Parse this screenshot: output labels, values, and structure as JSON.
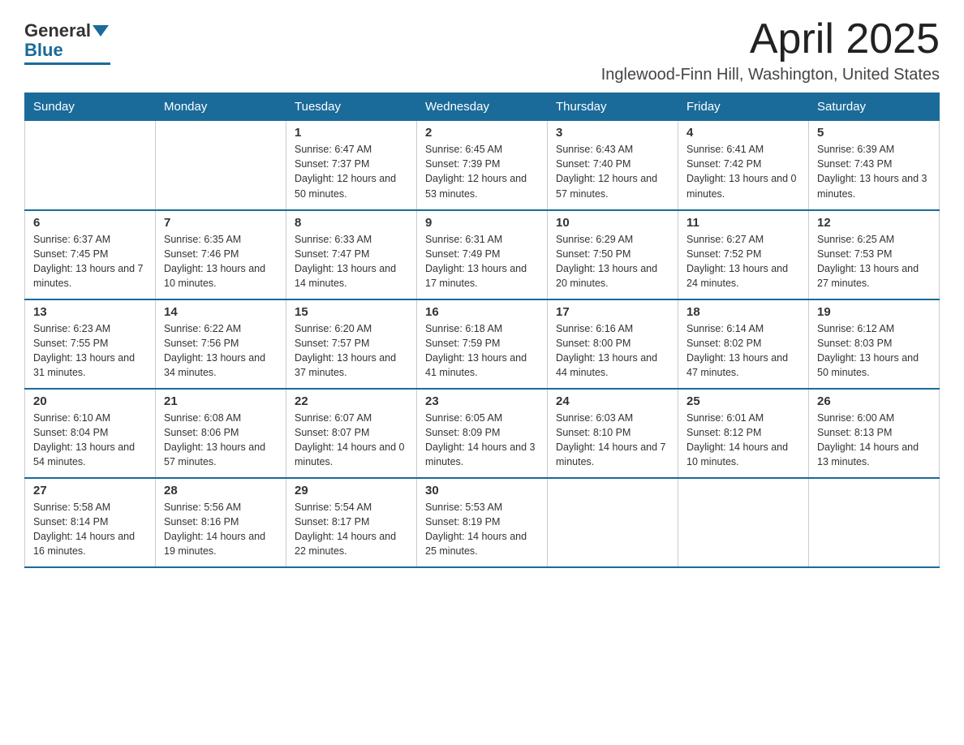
{
  "header": {
    "logo_general": "General",
    "logo_blue": "Blue",
    "month_title": "April 2025",
    "location": "Inglewood-Finn Hill, Washington, United States"
  },
  "days_of_week": [
    "Sunday",
    "Monday",
    "Tuesday",
    "Wednesday",
    "Thursday",
    "Friday",
    "Saturday"
  ],
  "weeks": [
    [
      {
        "day": "",
        "info": ""
      },
      {
        "day": "",
        "info": ""
      },
      {
        "day": "1",
        "info": "Sunrise: 6:47 AM\nSunset: 7:37 PM\nDaylight: 12 hours\nand 50 minutes."
      },
      {
        "day": "2",
        "info": "Sunrise: 6:45 AM\nSunset: 7:39 PM\nDaylight: 12 hours\nand 53 minutes."
      },
      {
        "day": "3",
        "info": "Sunrise: 6:43 AM\nSunset: 7:40 PM\nDaylight: 12 hours\nand 57 minutes."
      },
      {
        "day": "4",
        "info": "Sunrise: 6:41 AM\nSunset: 7:42 PM\nDaylight: 13 hours\nand 0 minutes."
      },
      {
        "day": "5",
        "info": "Sunrise: 6:39 AM\nSunset: 7:43 PM\nDaylight: 13 hours\nand 3 minutes."
      }
    ],
    [
      {
        "day": "6",
        "info": "Sunrise: 6:37 AM\nSunset: 7:45 PM\nDaylight: 13 hours\nand 7 minutes."
      },
      {
        "day": "7",
        "info": "Sunrise: 6:35 AM\nSunset: 7:46 PM\nDaylight: 13 hours\nand 10 minutes."
      },
      {
        "day": "8",
        "info": "Sunrise: 6:33 AM\nSunset: 7:47 PM\nDaylight: 13 hours\nand 14 minutes."
      },
      {
        "day": "9",
        "info": "Sunrise: 6:31 AM\nSunset: 7:49 PM\nDaylight: 13 hours\nand 17 minutes."
      },
      {
        "day": "10",
        "info": "Sunrise: 6:29 AM\nSunset: 7:50 PM\nDaylight: 13 hours\nand 20 minutes."
      },
      {
        "day": "11",
        "info": "Sunrise: 6:27 AM\nSunset: 7:52 PM\nDaylight: 13 hours\nand 24 minutes."
      },
      {
        "day": "12",
        "info": "Sunrise: 6:25 AM\nSunset: 7:53 PM\nDaylight: 13 hours\nand 27 minutes."
      }
    ],
    [
      {
        "day": "13",
        "info": "Sunrise: 6:23 AM\nSunset: 7:55 PM\nDaylight: 13 hours\nand 31 minutes."
      },
      {
        "day": "14",
        "info": "Sunrise: 6:22 AM\nSunset: 7:56 PM\nDaylight: 13 hours\nand 34 minutes."
      },
      {
        "day": "15",
        "info": "Sunrise: 6:20 AM\nSunset: 7:57 PM\nDaylight: 13 hours\nand 37 minutes."
      },
      {
        "day": "16",
        "info": "Sunrise: 6:18 AM\nSunset: 7:59 PM\nDaylight: 13 hours\nand 41 minutes."
      },
      {
        "day": "17",
        "info": "Sunrise: 6:16 AM\nSunset: 8:00 PM\nDaylight: 13 hours\nand 44 minutes."
      },
      {
        "day": "18",
        "info": "Sunrise: 6:14 AM\nSunset: 8:02 PM\nDaylight: 13 hours\nand 47 minutes."
      },
      {
        "day": "19",
        "info": "Sunrise: 6:12 AM\nSunset: 8:03 PM\nDaylight: 13 hours\nand 50 minutes."
      }
    ],
    [
      {
        "day": "20",
        "info": "Sunrise: 6:10 AM\nSunset: 8:04 PM\nDaylight: 13 hours\nand 54 minutes."
      },
      {
        "day": "21",
        "info": "Sunrise: 6:08 AM\nSunset: 8:06 PM\nDaylight: 13 hours\nand 57 minutes."
      },
      {
        "day": "22",
        "info": "Sunrise: 6:07 AM\nSunset: 8:07 PM\nDaylight: 14 hours\nand 0 minutes."
      },
      {
        "day": "23",
        "info": "Sunrise: 6:05 AM\nSunset: 8:09 PM\nDaylight: 14 hours\nand 3 minutes."
      },
      {
        "day": "24",
        "info": "Sunrise: 6:03 AM\nSunset: 8:10 PM\nDaylight: 14 hours\nand 7 minutes."
      },
      {
        "day": "25",
        "info": "Sunrise: 6:01 AM\nSunset: 8:12 PM\nDaylight: 14 hours\nand 10 minutes."
      },
      {
        "day": "26",
        "info": "Sunrise: 6:00 AM\nSunset: 8:13 PM\nDaylight: 14 hours\nand 13 minutes."
      }
    ],
    [
      {
        "day": "27",
        "info": "Sunrise: 5:58 AM\nSunset: 8:14 PM\nDaylight: 14 hours\nand 16 minutes."
      },
      {
        "day": "28",
        "info": "Sunrise: 5:56 AM\nSunset: 8:16 PM\nDaylight: 14 hours\nand 19 minutes."
      },
      {
        "day": "29",
        "info": "Sunrise: 5:54 AM\nSunset: 8:17 PM\nDaylight: 14 hours\nand 22 minutes."
      },
      {
        "day": "30",
        "info": "Sunrise: 5:53 AM\nSunset: 8:19 PM\nDaylight: 14 hours\nand 25 minutes."
      },
      {
        "day": "",
        "info": ""
      },
      {
        "day": "",
        "info": ""
      },
      {
        "day": "",
        "info": ""
      }
    ]
  ]
}
